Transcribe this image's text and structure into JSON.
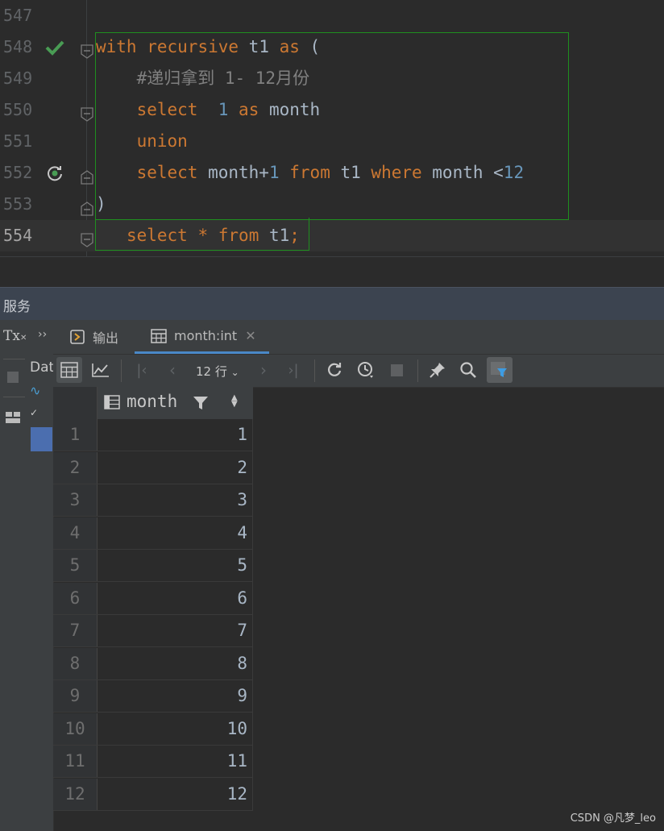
{
  "editor": {
    "lines": [
      {
        "num": "547",
        "parts": []
      },
      {
        "num": "548",
        "parts": [
          {
            "t": "with",
            "c": "kw"
          },
          {
            "t": " "
          },
          {
            "t": "recursive",
            "c": "kw"
          },
          {
            "t": " t1 "
          },
          {
            "t": "as",
            "c": "kw"
          },
          {
            "t": " ("
          }
        ]
      },
      {
        "num": "549",
        "parts": [
          {
            "t": "    "
          },
          {
            "t": "#递归拿到 1- 12月份",
            "c": "cmt"
          }
        ]
      },
      {
        "num": "550",
        "parts": [
          {
            "t": "    "
          },
          {
            "t": "select",
            "c": "kw"
          },
          {
            "t": "  "
          },
          {
            "t": "1",
            "c": "num"
          },
          {
            "t": " "
          },
          {
            "t": "as",
            "c": "kw"
          },
          {
            "t": " month"
          }
        ]
      },
      {
        "num": "551",
        "parts": [
          {
            "t": "    "
          },
          {
            "t": "union",
            "c": "kw"
          }
        ]
      },
      {
        "num": "552",
        "parts": [
          {
            "t": "    "
          },
          {
            "t": "select",
            "c": "kw"
          },
          {
            "t": " month+"
          },
          {
            "t": "1",
            "c": "num"
          },
          {
            "t": " "
          },
          {
            "t": "from",
            "c": "kw"
          },
          {
            "t": " t1 "
          },
          {
            "t": "where",
            "c": "kw"
          },
          {
            "t": " month <"
          },
          {
            "t": "12",
            "c": "num"
          }
        ]
      },
      {
        "num": "553",
        "parts": [
          {
            "t": ")"
          }
        ]
      },
      {
        "num": "554",
        "parts": [
          {
            "t": "   "
          },
          {
            "t": "select",
            "c": "kw"
          },
          {
            "t": " "
          },
          {
            "t": "*",
            "c": "kw"
          },
          {
            "t": " "
          },
          {
            "t": "from",
            "c": "kw"
          },
          {
            "t": " t1"
          },
          {
            "t": ";",
            "c": "semi"
          }
        ]
      }
    ]
  },
  "services": {
    "title": "服务",
    "left_label": "Tx",
    "tree_label": "Dat",
    "tabs": [
      {
        "label": "输出",
        "icon": "output-icon"
      },
      {
        "label": "month:int",
        "icon": "table-icon"
      }
    ],
    "rows_selector": "12 行"
  },
  "grid": {
    "column": "month",
    "rows": [
      {
        "n": "1",
        "v": "1"
      },
      {
        "n": "2",
        "v": "2"
      },
      {
        "n": "3",
        "v": "3"
      },
      {
        "n": "4",
        "v": "4"
      },
      {
        "n": "5",
        "v": "5"
      },
      {
        "n": "6",
        "v": "6"
      },
      {
        "n": "7",
        "v": "7"
      },
      {
        "n": "8",
        "v": "8"
      },
      {
        "n": "9",
        "v": "9"
      },
      {
        "n": "10",
        "v": "10"
      },
      {
        "n": "11",
        "v": "11"
      },
      {
        "n": "12",
        "v": "12"
      }
    ]
  },
  "watermark": "CSDN @凡梦_leo"
}
